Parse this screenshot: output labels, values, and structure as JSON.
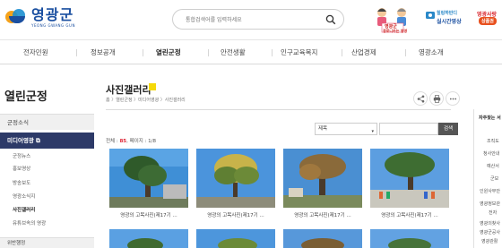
{
  "header": {
    "logo_name": "영광군",
    "logo_sub": "YEONG GWANG GUN",
    "search_placeholder": "통합검색어를 입력하세요",
    "promo1_line1": "영광군",
    "promo1_line2": "경로니카는 영영",
    "promo2_line1": "힐링하반디",
    "promo2_line2": "실시간영상",
    "promo3_line1": "영광사랑",
    "promo3_line2": "상품권"
  },
  "nav": {
    "items": [
      "전자민원",
      "정보공개",
      "열린군정",
      "안전생활",
      "인구교육복지",
      "산업경제",
      "영광소개"
    ],
    "active_index": 2
  },
  "sidebar": {
    "title": "열린군정",
    "menu": [
      {
        "label": "군정소식",
        "state": "plain"
      },
      {
        "label": "미디어영광 ⧉",
        "state": "active"
      }
    ],
    "sub_items": [
      "군정뉴스",
      "홍보영상",
      "방송보도",
      "영광소식지",
      "사진갤러리",
      "유튜브속의 영광"
    ],
    "current_sub": 4,
    "bottom_item": "위반행정"
  },
  "content": {
    "title": "사진갤러리",
    "breadcrumb": "홈 〉열린군정 〉미디어영광 〉사진갤러리",
    "select_value": "제목",
    "search_button": "검색",
    "count_label": "전체 : ",
    "count_value": "85",
    "page_info": ", 페이지 : 1/8",
    "cards": [
      {
        "caption": "영광의 고목사진(제17기 ..."
      },
      {
        "caption": "영광의 고목사진(제17기 ..."
      },
      {
        "caption": "영광의 고목사진(제17기 ..."
      },
      {
        "caption": "영광의 고목사진(제17기 ..."
      }
    ]
  },
  "right_panel": {
    "title": "자주찾는 서",
    "items": [
      "조직도",
      "청사안내",
      "예산서",
      "군보",
      "인원사무안",
      "영광정보관",
      "전자",
      "영광의찾사",
      "영광군공사",
      "영광관활",
      "성과관"
    ]
  },
  "colors": {
    "brand": "#1a4fa0",
    "active_menu": "#2d3a68",
    "title_mark": "#f5d90a",
    "count_highlight": "#dd2233"
  }
}
